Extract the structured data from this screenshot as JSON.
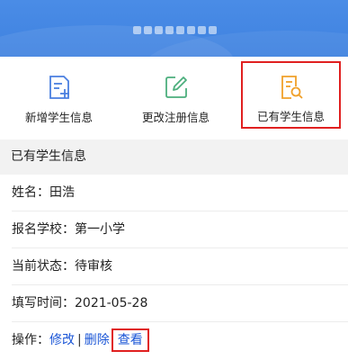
{
  "nav": {
    "items": [
      {
        "label": "新增学生信息",
        "icon": "add-document-icon"
      },
      {
        "label": "更改注册信息",
        "icon": "edit-icon"
      },
      {
        "label": "已有学生信息",
        "icon": "search-document-icon"
      }
    ]
  },
  "section": {
    "title": "已有学生信息"
  },
  "record": {
    "name_label": "姓名：",
    "name_value": "田浩",
    "school_label": "报名学校：",
    "school_value": "第一小学",
    "status_label": "当前状态：",
    "status_value": "待审核",
    "time_label": "填写时间：",
    "time_value": "2021-05-28",
    "ops_label": "操作：",
    "edit": "修改",
    "sep": "|",
    "delete": "删除",
    "view": "查看"
  },
  "colors": {
    "header": "#3f82e0",
    "icon_blue": "#4a7fe0",
    "icon_green": "#4caf7d",
    "icon_orange": "#f0a02a",
    "link": "#1a55d6",
    "highlight": "#e02020"
  }
}
